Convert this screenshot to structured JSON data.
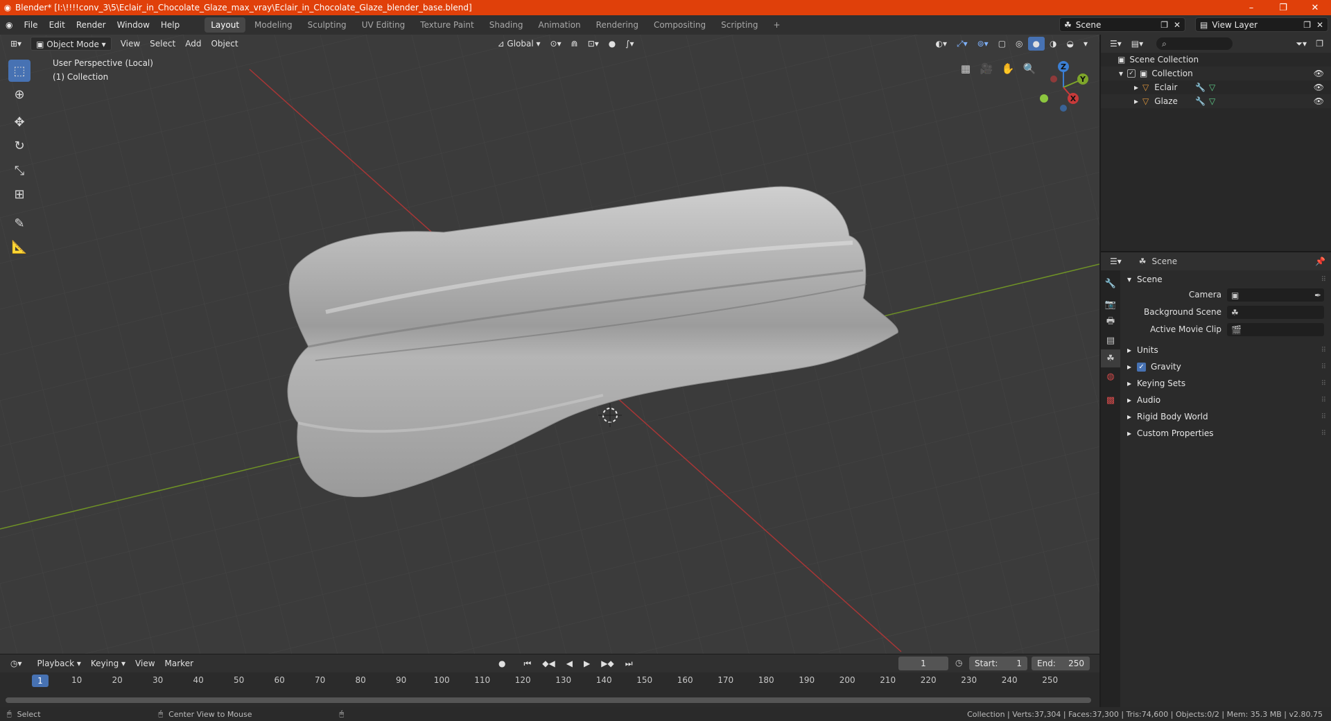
{
  "window": {
    "title": "Blender* [I:\\!!!!conv_3\\5\\Eclair_in_Chocolate_Glaze_max_vray\\Eclair_in_Chocolate_Glaze_blender_base.blend]",
    "minimize": "–",
    "maximize": "❐",
    "close": "✕"
  },
  "menu": [
    "File",
    "Edit",
    "Render",
    "Window",
    "Help"
  ],
  "workspaces": [
    "Layout",
    "Modeling",
    "Sculpting",
    "UV Editing",
    "Texture Paint",
    "Shading",
    "Animation",
    "Rendering",
    "Compositing",
    "Scripting"
  ],
  "active_workspace": "Layout",
  "add_workspace": "+",
  "scene_selector": "Scene",
  "view_layer_selector": "View Layer",
  "viewport": {
    "mode": "Object Mode",
    "menus": [
      "View",
      "Select",
      "Add",
      "Object"
    ],
    "orientation": "Global",
    "info_line1": "User Perspective (Local)",
    "info_line2": "(1) Collection",
    "gizmo": {
      "z": "Z",
      "y": "Y",
      "x": "X"
    },
    "colors": {
      "x_axis": "#c83a3a",
      "y_axis": "#7ea52a",
      "z_axis": "#3b7fd4",
      "bg": "#3b3b3b",
      "mesh": "#b7b7b7"
    }
  },
  "outliner": {
    "root": "Scene Collection",
    "collection": "Collection",
    "objects": [
      "Eclair",
      "Glaze"
    ]
  },
  "properties": {
    "header_title": "Scene",
    "panel_title": "Scene",
    "camera_label": "Camera",
    "background_scene_label": "Background Scene",
    "active_movie_clip_label": "Active Movie Clip",
    "subpanels": [
      "Units",
      "Gravity",
      "Keying Sets",
      "Audio",
      "Rigid Body World",
      "Custom Properties"
    ]
  },
  "timeline": {
    "menus": [
      "Playback",
      "Keying",
      "View",
      "Marker"
    ],
    "current_frame": "1",
    "start_label": "Start:",
    "start": "1",
    "end_label": "End:",
    "end": "250",
    "ticks": [
      "10",
      "20",
      "30",
      "40",
      "50",
      "60",
      "70",
      "80",
      "90",
      "100",
      "110",
      "120",
      "130",
      "140",
      "150",
      "160",
      "170",
      "180",
      "190",
      "200",
      "210",
      "220",
      "230",
      "240",
      "250"
    ],
    "cursor_frame": "1"
  },
  "statusbar": {
    "select": "Select",
    "center_view": "Center View to Mouse",
    "stats": "Collection | Verts:37,304 | Faces:37,300 | Tris:74,600 | Objects:0/2 | Mem: 35.3 MB | v2.80.75"
  }
}
